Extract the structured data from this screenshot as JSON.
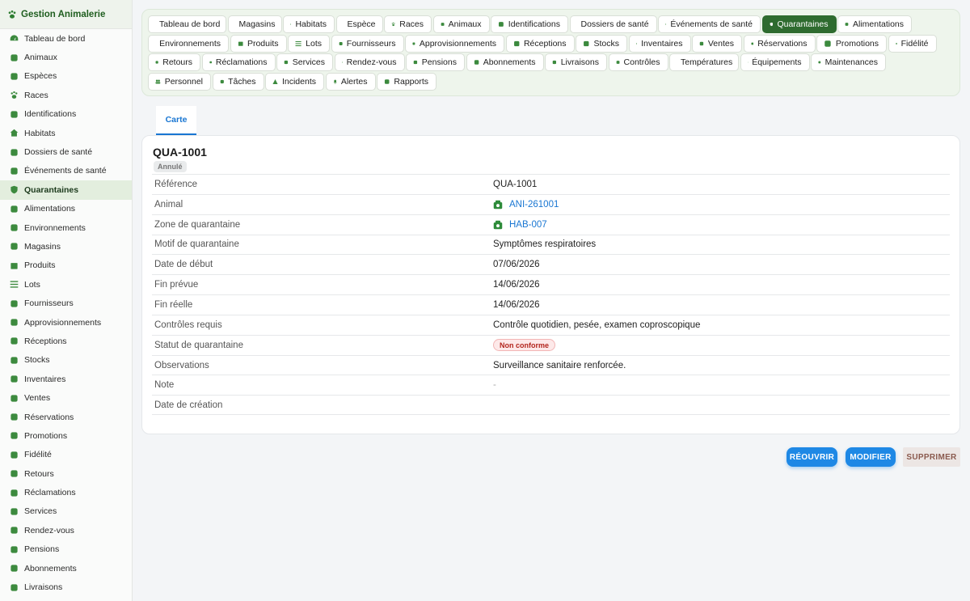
{
  "app": {
    "title": "Gestion Animalerie"
  },
  "sidebar": {
    "items": [
      {
        "label": "Tableau de bord",
        "icon": "dashboard-icon"
      },
      {
        "label": "Animaux",
        "icon": "cat-icon"
      },
      {
        "label": "Espèces",
        "icon": "dna-icon"
      },
      {
        "label": "Races",
        "icon": "paw-icon"
      },
      {
        "label": "Identifications",
        "icon": "fingerprint-icon"
      },
      {
        "label": "Habitats",
        "icon": "house-icon"
      },
      {
        "label": "Dossiers de santé",
        "icon": "medical-file-icon"
      },
      {
        "label": "Événements de santé",
        "icon": "syringe-icon"
      },
      {
        "label": "Quarantaines",
        "icon": "shield-icon",
        "active": true
      },
      {
        "label": "Alimentations",
        "icon": "utensils-icon"
      },
      {
        "label": "Environnements",
        "icon": "thermometer-icon"
      },
      {
        "label": "Magasins",
        "icon": "store-icon"
      },
      {
        "label": "Produits",
        "icon": "box-icon"
      },
      {
        "label": "Lots",
        "icon": "list-icon"
      },
      {
        "label": "Fournisseurs",
        "icon": "truck-icon"
      },
      {
        "label": "Approvisionnements",
        "icon": "cart-icon"
      },
      {
        "label": "Réceptions",
        "icon": "dolly-icon"
      },
      {
        "label": "Stocks",
        "icon": "warehouse-icon"
      },
      {
        "label": "Inventaires",
        "icon": "clipboard-check-icon"
      },
      {
        "label": "Ventes",
        "icon": "cash-register-icon"
      },
      {
        "label": "Réservations",
        "icon": "bookmark-icon"
      },
      {
        "label": "Promotions",
        "icon": "tags-icon"
      },
      {
        "label": "Fidélité",
        "icon": "award-icon"
      },
      {
        "label": "Retours",
        "icon": "undo-icon"
      },
      {
        "label": "Réclamations",
        "icon": "comment-icon"
      },
      {
        "label": "Services",
        "icon": "bell-concierge-icon"
      },
      {
        "label": "Rendez-vous",
        "icon": "calendar-check-icon"
      },
      {
        "label": "Pensions",
        "icon": "bed-icon"
      },
      {
        "label": "Abonnements",
        "icon": "refresh-icon"
      },
      {
        "label": "Livraisons",
        "icon": "truck-fast-icon"
      }
    ]
  },
  "tabs": {
    "rows": [
      [
        {
          "label": "Tableau de bord",
          "icon": "dashboard-icon",
          "w": 97
        },
        {
          "label": "Magasins",
          "icon": "store-icon",
          "w": 67
        },
        {
          "label": "Habitats",
          "icon": "house-icon",
          "w": 64
        },
        {
          "label": "Espèce",
          "icon": "dna-icon",
          "w": 58
        },
        {
          "label": "Races",
          "icon": "paw-icon",
          "w": 59
        },
        {
          "label": "Animaux",
          "icon": "cat-icon",
          "w": 70
        },
        {
          "label": "Identifications",
          "icon": "fingerprint-icon",
          "w": 96
        },
        {
          "label": "Dossiers de santé",
          "icon": "medical-file-icon",
          "w": 108
        },
        {
          "label": "Événements de santé",
          "icon": "syringe-icon",
          "w": 127
        },
        {
          "label": "Quarantaines",
          "icon": "shield-icon",
          "w": 92,
          "active": true
        },
        {
          "label": "Alimentations",
          "icon": "utensils-icon",
          "w": 92
        }
      ],
      [
        {
          "label": "Environnements",
          "icon": "thermometer-icon",
          "w": 100
        },
        {
          "label": "Produits",
          "icon": "box-icon",
          "w": 70
        },
        {
          "label": "Lots",
          "icon": "list-icon",
          "w": 52
        },
        {
          "label": "Fournisseurs",
          "icon": "truck-icon",
          "w": 90
        },
        {
          "label": "Approvisionnements",
          "icon": "cart-icon",
          "w": 123
        },
        {
          "label": "Réceptions",
          "icon": "dolly-icon",
          "w": 85
        },
        {
          "label": "Stocks",
          "icon": "warehouse-icon",
          "w": 64
        },
        {
          "label": "Inventaires",
          "icon": "clipboard-check-icon",
          "w": 77
        },
        {
          "label": "Ventes",
          "icon": "cash-register-icon",
          "w": 62
        },
        {
          "label": "Réservations",
          "icon": "bookmark-icon",
          "w": 89
        },
        {
          "label": "Promotions",
          "icon": "tags-icon",
          "w": 87
        },
        {
          "label": "Fidélité",
          "icon": "award-icon",
          "w": 60
        }
      ],
      [
        {
          "label": "Retours",
          "icon": "undo-icon",
          "w": 65
        },
        {
          "label": "Réclamations",
          "icon": "comment-icon",
          "w": 91
        },
        {
          "label": "Services",
          "icon": "bell-concierge-icon",
          "w": 70
        },
        {
          "label": "Rendez-vous",
          "icon": "calendar-check-icon",
          "w": 87
        },
        {
          "label": "Pensions",
          "icon": "bed-icon",
          "w": 73
        },
        {
          "label": "Abonnements",
          "icon": "refresh-icon",
          "w": 96
        },
        {
          "label": "Livraisons",
          "icon": "truck-fast-icon",
          "w": 77
        },
        {
          "label": "Contrôles",
          "icon": "clipboard-icon",
          "w": 74
        },
        {
          "label": "Températures",
          "icon": "thermometer-icon",
          "w": 86
        },
        {
          "label": "Équipements",
          "icon": "tools-icon",
          "w": 86
        },
        {
          "label": "Maintenances",
          "icon": "wrench-icon",
          "w": 93
        }
      ],
      [
        {
          "label": "Personnel",
          "icon": "users-icon",
          "w": 78
        },
        {
          "label": "Tâches",
          "icon": "tasks-icon",
          "w": 64
        },
        {
          "label": "Incidents",
          "icon": "warning-icon",
          "w": 73
        },
        {
          "label": "Alertes",
          "icon": "bell-icon",
          "w": 62
        },
        {
          "label": "Rapports",
          "icon": "pie-chart-icon",
          "w": 74
        }
      ]
    ]
  },
  "card_tab": {
    "label": "Carte"
  },
  "record": {
    "title": "QUA-1001",
    "status": "Annulé",
    "fields": [
      {
        "label": "Référence",
        "value": "QUA-1001",
        "type": "text"
      },
      {
        "label": "Animal",
        "value": "ANI-261001",
        "type": "link"
      },
      {
        "label": "Zone de quarantaine",
        "value": "HAB-007",
        "type": "link"
      },
      {
        "label": "Motif de quarantaine",
        "value": "Symptômes respiratoires",
        "type": "text"
      },
      {
        "label": "Date de début",
        "value": "07/06/2026",
        "type": "text"
      },
      {
        "label": "Fin prévue",
        "value": "14/06/2026",
        "type": "text"
      },
      {
        "label": "Fin réelle",
        "value": "14/06/2026",
        "type": "text"
      },
      {
        "label": "Contrôles requis",
        "value": "Contrôle quotidien, pesée, examen coproscopique",
        "type": "text"
      },
      {
        "label": "Statut de quarantaine",
        "value": "Non conforme",
        "type": "pill"
      },
      {
        "label": "Observations",
        "value": "Surveillance sanitaire renforcée.",
        "type": "text"
      },
      {
        "label": "Note",
        "value": "-",
        "type": "muted"
      },
      {
        "label": "Date de création",
        "value": "",
        "type": "text"
      }
    ]
  },
  "actions": {
    "reopen": "RÉOUVRIR",
    "edit": "MODIFIER",
    "delete": "SUPPRIMER"
  },
  "colors": {
    "accent": "#1e88e5",
    "brand": "#2e6b2f",
    "danger_pill": "#b3261e"
  }
}
